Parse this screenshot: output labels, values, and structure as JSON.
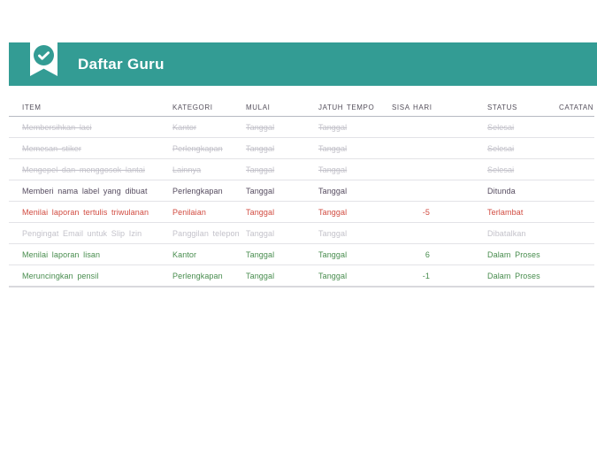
{
  "header": {
    "title": "Daftar Guru",
    "icon": "checkmark-ribbon"
  },
  "colors": {
    "accent_teal": "#339c94",
    "status_done": "#c3c2ca",
    "status_postponed": "#554b5f",
    "status_late": "#d14b40",
    "status_canceled": "#c3c2ca",
    "status_in_progress": "#478c4d",
    "header_text": "#55505c"
  },
  "table": {
    "columns": [
      "ITEM",
      "KATEGORI",
      "MULAI",
      "JATUH TEMPO",
      "SISA HARI",
      "STATUS",
      "CATATAN"
    ],
    "rows": [
      {
        "item": "Membersihkan laci",
        "kategori": "Kantor",
        "mulai": "Tanggal",
        "jatuh_tempo": "Tanggal",
        "sisa_hari": "",
        "status": "Selesai",
        "catatan": "",
        "style": "done"
      },
      {
        "item": "Memesan stiker",
        "kategori": "Perlengkapan",
        "mulai": "Tanggal",
        "jatuh_tempo": "Tanggal",
        "sisa_hari": "",
        "status": "Selesai",
        "catatan": "",
        "style": "done"
      },
      {
        "item": "Mengepel dan menggosok lantai",
        "kategori": "Lainnya",
        "mulai": "Tanggal",
        "jatuh_tempo": "Tanggal",
        "sisa_hari": "",
        "status": "Selesai",
        "catatan": "",
        "style": "done"
      },
      {
        "item": "Memberi nama label yang dibuat",
        "kategori": "Perlengkapan",
        "mulai": "Tanggal",
        "jatuh_tempo": "Tanggal",
        "sisa_hari": "",
        "status": "Ditunda",
        "catatan": "",
        "style": "postponed"
      },
      {
        "item": "Menilai laporan tertulis triwulanan",
        "kategori": "Penilaian",
        "mulai": "Tanggal",
        "jatuh_tempo": "Tanggal",
        "sisa_hari": "-5",
        "status": "Terlambat",
        "catatan": "",
        "style": "late"
      },
      {
        "item": "Pengingat Email untuk Slip Izin",
        "kategori": "Panggilan telepon",
        "mulai": "Tanggal",
        "jatuh_tempo": "Tanggal",
        "sisa_hari": "",
        "status": "Dibatalkan",
        "catatan": "",
        "style": "canceled"
      },
      {
        "item": "Menilai laporan lisan",
        "kategori": "Kantor",
        "mulai": "Tanggal",
        "jatuh_tempo": "Tanggal",
        "sisa_hari": "6",
        "status": "Dalam Proses",
        "catatan": "",
        "style": "inprogress"
      },
      {
        "item": "Meruncingkan pensil",
        "kategori": "Perlengkapan",
        "mulai": "Tanggal",
        "jatuh_tempo": "Tanggal",
        "sisa_hari": "-1",
        "status": "Dalam Proses",
        "catatan": "",
        "style": "inprogress"
      }
    ]
  }
}
